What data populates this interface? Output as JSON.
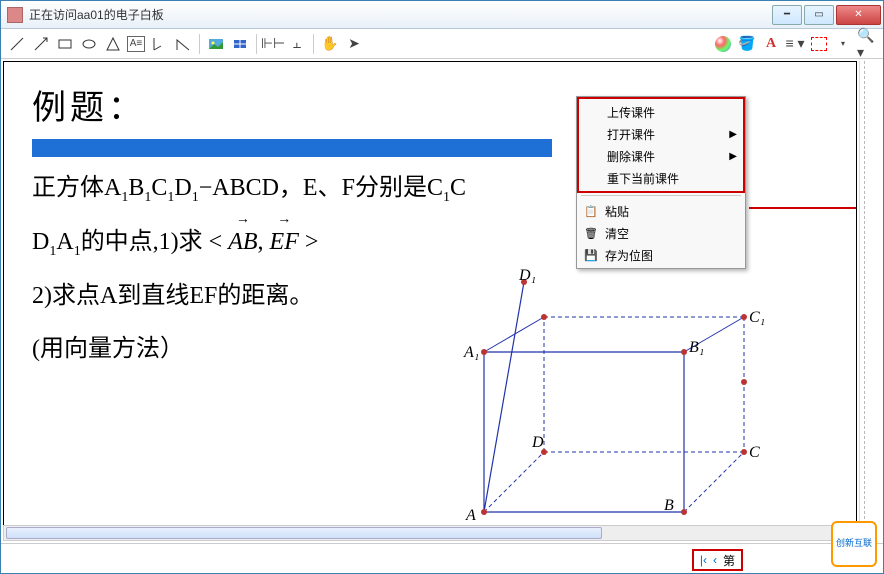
{
  "window": {
    "title": "正在访问aa01的电子白板"
  },
  "content": {
    "heading": "例题：",
    "line1_a": "正方体A",
    "line1_b": "B",
    "line1_c": "C",
    "line1_d": "D",
    "line1_e": "−ABCD，E、F分别是C",
    "line1_f": "C",
    "line2_a": "D",
    "line2_b": "A",
    "line2_c": "的中点,1)求 < ",
    "line2_vec1": "AB",
    "line2_comma": ", ",
    "line2_vec2": "EF",
    "line2_d": " >",
    "line3": "2)求点A到直线EF的距离。",
    "line4": "(用向量方法）",
    "sub1": "1"
  },
  "geom_labels": {
    "A": "A",
    "B": "B",
    "C": "C",
    "D": "D",
    "A1": "A₁",
    "B1": "B₁",
    "C1": "C₁",
    "D1": "D₁"
  },
  "context_menu": {
    "upload": "上传课件",
    "open": "打开课件",
    "delete": "删除课件",
    "redownload": "重下当前课件",
    "paste": "粘贴",
    "clear": "清空",
    "saveimg": "存为位图"
  },
  "statusbar": {
    "first": "|‹",
    "prev": "‹",
    "page_label": "第"
  },
  "watermark": "创新互联"
}
